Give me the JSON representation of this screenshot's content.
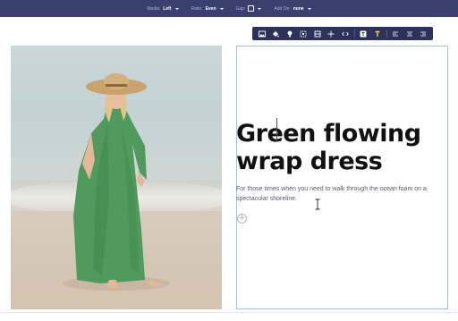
{
  "topbar": {
    "media": {
      "label": "Media:",
      "value": "Left"
    },
    "ratio": {
      "label": "Ratio:",
      "value": "Even"
    },
    "gap": {
      "label": "Gap:"
    },
    "add_on": {
      "label": "Add On:",
      "value": "none"
    }
  },
  "toolbar": {
    "icons": [
      "image-icon",
      "fill-icon",
      "bulb-icon",
      "crop-icon",
      "layout-icon",
      "move-icon",
      "code-icon",
      "text-style-icon",
      "text-color-icon",
      "align-left-icon",
      "align-center-icon",
      "align-right-icon"
    ]
  },
  "content": {
    "heading": "Green flowing wrap dress",
    "body": "For those times when you need to walk through the ocean foam on a spectacular shoreline.",
    "add_symbol": "+"
  },
  "colors": {
    "topbar_bg": "#3b3f6e",
    "toolbar_bg": "#2d315c",
    "dress_green": "#4f9a5c",
    "selection_border": "#9fc4d3",
    "text_color_accent": "#f2d24a"
  }
}
